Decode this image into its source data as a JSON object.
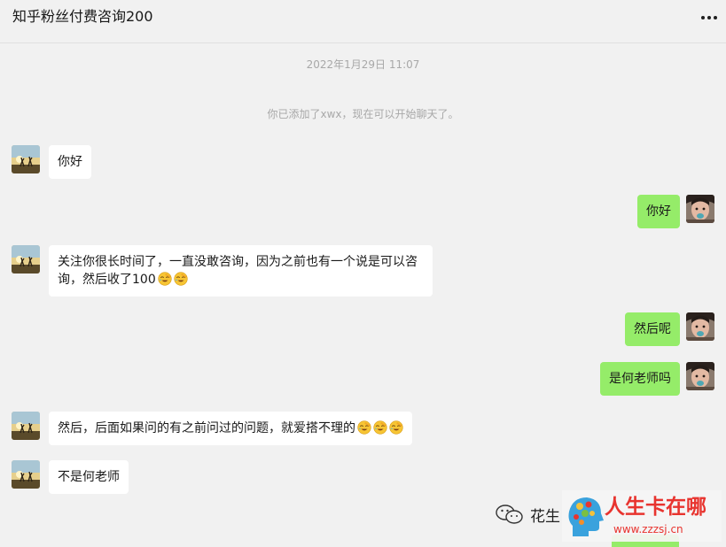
{
  "header": {
    "title": "知乎粉丝付费咨询200",
    "more_icon": "more-horizontal-icon"
  },
  "system": {
    "timestamp": "2022年1月29日 11:07",
    "added_notice": "你已添加了xwx，现在可以开始聊天了。"
  },
  "messages": [
    {
      "side": "left",
      "text": "你好",
      "emoji_count": 0
    },
    {
      "side": "right",
      "text": "你好",
      "emoji_count": 0
    },
    {
      "side": "left",
      "text": "关注你很长时间了，一直没敢咨询，因为之前也有一个说是可以咨询，然后收了100",
      "emoji_count": 2,
      "emoji": "facepalm-laugh-emoji"
    },
    {
      "side": "right",
      "text": "然后呢",
      "emoji_count": 0
    },
    {
      "side": "right",
      "text": "是何老师吗",
      "emoji_count": 0
    },
    {
      "side": "left",
      "text": "然后，后面如果问的有之前问过的问题，就爱搭不理的",
      "emoji_count": 3,
      "emoji": "facepalm-laugh-emoji"
    },
    {
      "side": "left",
      "text": "不是何老师",
      "emoji_count": 0
    }
  ],
  "watermarks": {
    "account_name": "花生",
    "site_title": "人生卡在哪",
    "site_url": "www.zzzsj.cn"
  },
  "colors": {
    "background": "#f1f1f1",
    "bubble_self": "#95ec69",
    "bubble_other": "#ffffff",
    "system_text": "#a8a8a8",
    "watermark_red": "#e8342f"
  }
}
